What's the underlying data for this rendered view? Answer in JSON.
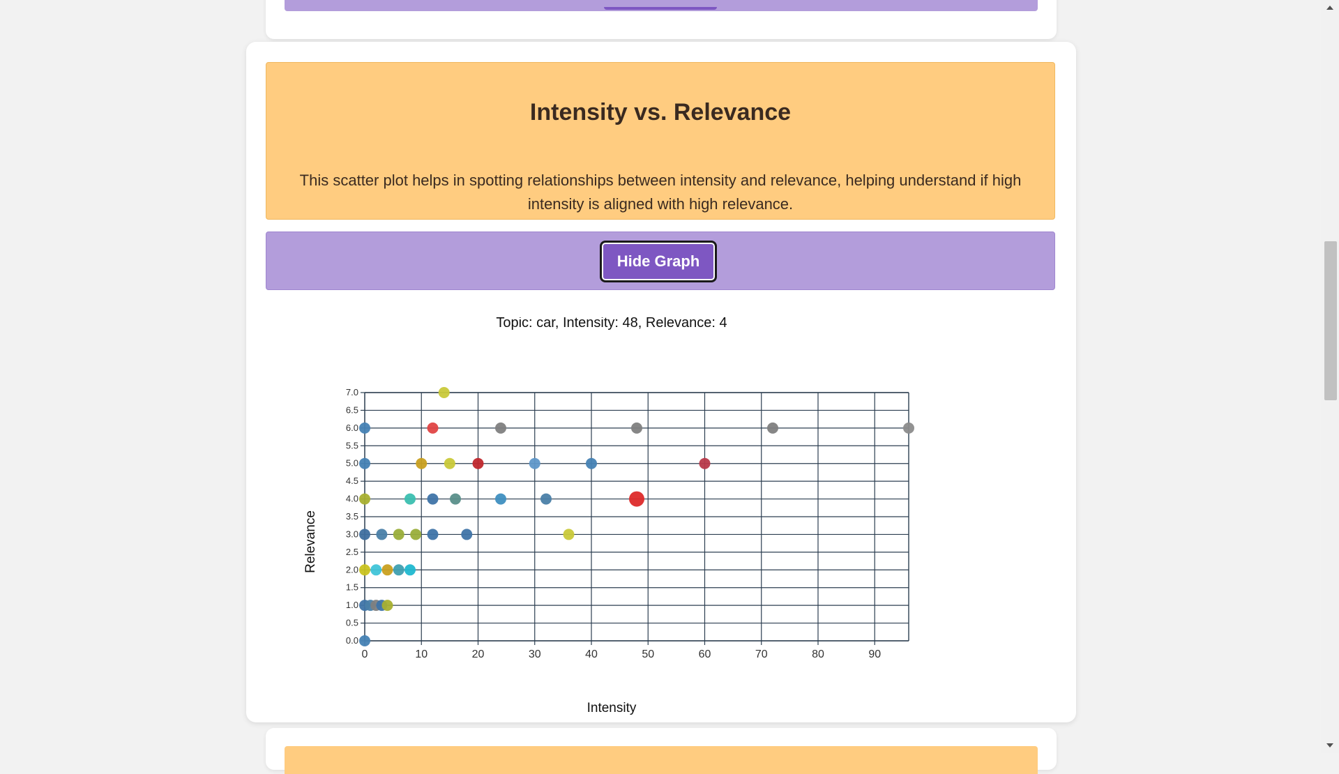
{
  "header": {
    "title": "Intensity vs. Relevance",
    "description": "This scatter plot helps in spotting relationships between intensity and relevance, helping understand if high intensity is aligned with high relevance."
  },
  "controls": {
    "hide_button_label": "Hide Graph"
  },
  "colors": {
    "header_bg": "#ffcc80",
    "button_bar_bg": "#b39ddb",
    "button_bg": "#7e57c2",
    "grid": "#2c3e50"
  },
  "chart_data": {
    "type": "scatter",
    "title": "Topic: car, Intensity: 48, Relevance: 4",
    "xlabel": "Intensity",
    "ylabel": "Relevance",
    "xlim": [
      0,
      96
    ],
    "ylim": [
      0,
      7
    ],
    "xticks": [
      0,
      10,
      20,
      30,
      40,
      50,
      60,
      70,
      80,
      90
    ],
    "yticks": [
      0.0,
      0.5,
      1.0,
      1.5,
      2.0,
      2.5,
      3.0,
      3.5,
      4.0,
      4.5,
      5.0,
      5.5,
      6.0,
      6.5,
      7.0
    ],
    "grid": true,
    "highlight": {
      "x": 48,
      "y": 4
    },
    "points": [
      {
        "x": 14,
        "y": 7,
        "color": "#c9c93a"
      },
      {
        "x": 0,
        "y": 6,
        "color": "#4682b4"
      },
      {
        "x": 12,
        "y": 6,
        "color": "#e04545"
      },
      {
        "x": 24,
        "y": 6,
        "color": "#7f7f7f"
      },
      {
        "x": 48,
        "y": 6,
        "color": "#7f7f7f"
      },
      {
        "x": 72,
        "y": 6,
        "color": "#7f7f7f"
      },
      {
        "x": 96,
        "y": 6,
        "color": "#8c8c8c"
      },
      {
        "x": 0,
        "y": 5,
        "color": "#4682b4"
      },
      {
        "x": 10,
        "y": 5,
        "color": "#c9a020"
      },
      {
        "x": 15,
        "y": 5,
        "color": "#c9c93a"
      },
      {
        "x": 20,
        "y": 5,
        "color": "#c0282d"
      },
      {
        "x": 30,
        "y": 5,
        "color": "#5f97c9"
      },
      {
        "x": 40,
        "y": 5,
        "color": "#4682b4"
      },
      {
        "x": 60,
        "y": 5,
        "color": "#b83a4a"
      },
      {
        "x": 0,
        "y": 4,
        "color": "#a8b030"
      },
      {
        "x": 8,
        "y": 4,
        "color": "#3bbfb0"
      },
      {
        "x": 12,
        "y": 4,
        "color": "#3f74a8"
      },
      {
        "x": 16,
        "y": 4,
        "color": "#5a8f8a"
      },
      {
        "x": 24,
        "y": 4,
        "color": "#3f8fc0"
      },
      {
        "x": 32,
        "y": 4,
        "color": "#4a7fa8"
      },
      {
        "x": 48,
        "y": 4,
        "color": "#dd2a2a"
      },
      {
        "x": 0,
        "y": 3,
        "color": "#3f6f9f"
      },
      {
        "x": 3,
        "y": 3,
        "color": "#4a7fa8"
      },
      {
        "x": 6,
        "y": 3,
        "color": "#9aae3a"
      },
      {
        "x": 9,
        "y": 3,
        "color": "#9aae3a"
      },
      {
        "x": 12,
        "y": 3,
        "color": "#3f74a8"
      },
      {
        "x": 18,
        "y": 3,
        "color": "#3f74a8"
      },
      {
        "x": 36,
        "y": 3,
        "color": "#c9c93a"
      },
      {
        "x": 0,
        "y": 2,
        "color": "#c9c320"
      },
      {
        "x": 2,
        "y": 2,
        "color": "#40c4d8"
      },
      {
        "x": 4,
        "y": 2,
        "color": "#c9a020"
      },
      {
        "x": 6,
        "y": 2,
        "color": "#3f9fb0"
      },
      {
        "x": 8,
        "y": 2,
        "color": "#20b8d0"
      },
      {
        "x": 0,
        "y": 1,
        "color": "#3f74a8"
      },
      {
        "x": 1,
        "y": 1,
        "color": "#4a7fa8"
      },
      {
        "x": 2,
        "y": 1,
        "color": "#7f7f7f"
      },
      {
        "x": 3,
        "y": 1,
        "color": "#3f74a8"
      },
      {
        "x": 4,
        "y": 1,
        "color": "#a8b030"
      },
      {
        "x": 0,
        "y": 0,
        "color": "#4682b4"
      }
    ]
  }
}
